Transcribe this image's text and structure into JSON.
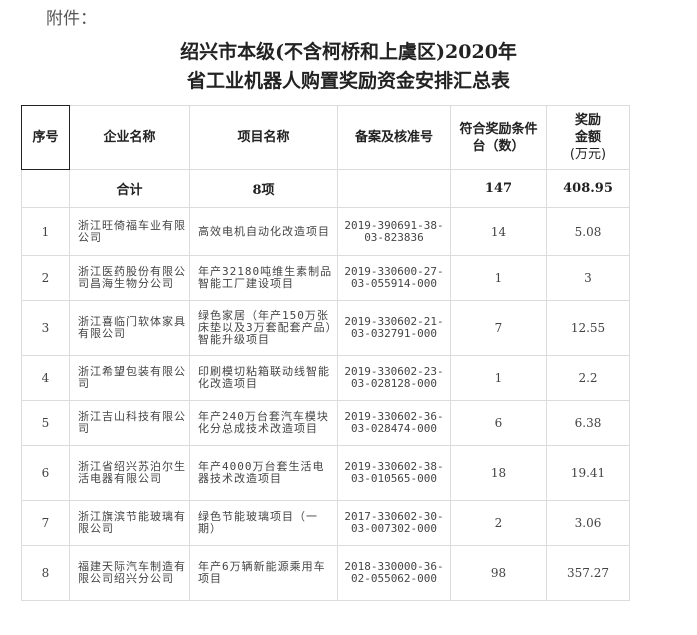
{
  "attachment_label": "附件：",
  "title_line1": "绍兴市本级(不含柯桥和上虞区)2020年",
  "title_line2": "省工业机器人购置奖励资金安排汇总表",
  "headers": {
    "seq": "序号",
    "company": "企业名称",
    "project": "项目名称",
    "approval": "备案及核准号",
    "units": "符合奖励条件台（数）",
    "amount_l1": "奖励",
    "amount_l2": "金额",
    "amount_l3": "(万元)"
  },
  "total": {
    "label": "合计",
    "project_count": "8项",
    "units": "147",
    "amount": "408.95"
  },
  "rows": [
    {
      "seq": "1",
      "company": "浙江旺倚福车业有限公司",
      "project": "高效电机自动化改造项目",
      "approval": "2019-390691-38-03-823836",
      "units": "14",
      "amount": "5.08"
    },
    {
      "seq": "2",
      "company": "浙江医药股份有限公司昌海生物分公司",
      "project": "年产32180吨维生素制品智能工厂建设项目",
      "approval": "2019-330600-27-03-055914-000",
      "units": "1",
      "amount": "3"
    },
    {
      "seq": "3",
      "company": "浙江喜临门软体家具有限公司",
      "project": "绿色家居（年产150万张床垫以及3万套配套产品）智能升级项目",
      "approval": "2019-330602-21-03-032791-000",
      "units": "7",
      "amount": "12.55"
    },
    {
      "seq": "4",
      "company": "浙江希望包装有限公司",
      "project": "印刷模切粘箱联动线智能化改造项目",
      "approval": "2019-330602-23-03-028128-000",
      "units": "1",
      "amount": "2.2"
    },
    {
      "seq": "5",
      "company": "浙江吉山科技有限公司",
      "project": "年产240万台套汽车模块化分总成技术改造项目",
      "approval": "2019-330602-36-03-028474-000",
      "units": "6",
      "amount": "6.38"
    },
    {
      "seq": "6",
      "company": "浙江省绍兴苏泊尔生活电器有限公司",
      "project": "年产4000万台套生活电器技术改造项目",
      "approval": "2019-330602-38-03-010565-000",
      "units": "18",
      "amount": "19.41"
    },
    {
      "seq": "7",
      "company": "浙江旗滨节能玻璃有限公司",
      "project": "绿色节能玻璃项目（一期）",
      "approval": "2017-330602-30-03-007302-000",
      "units": "2",
      "amount": "3.06"
    },
    {
      "seq": "8",
      "company": "福建天际汽车制造有限公司绍兴分公司",
      "project": "年产6万辆新能源乘用车项目",
      "approval": "2018-330000-36-02-055062-000",
      "units": "98",
      "amount": "357.27"
    }
  ]
}
